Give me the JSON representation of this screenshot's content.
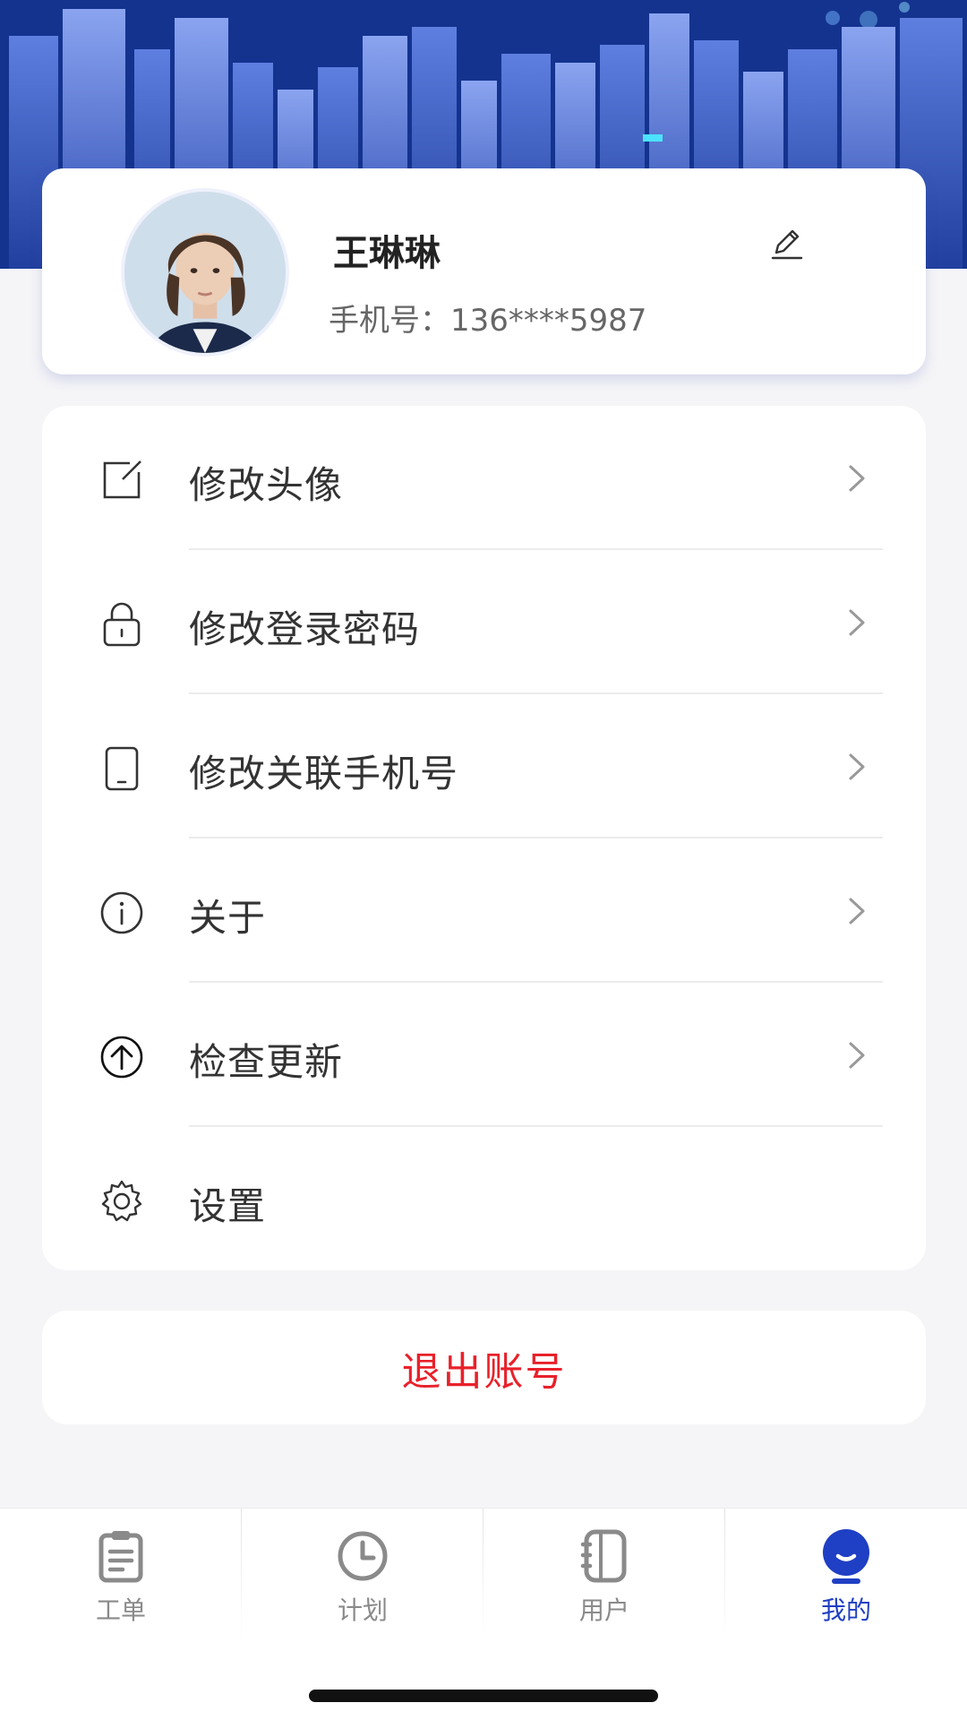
{
  "profile": {
    "name": "王琳琳",
    "phone": "手机号：136****5987"
  },
  "menu": {
    "items": [
      {
        "label": "修改头像",
        "icon": "edit-square-icon"
      },
      {
        "label": "修改登录密码",
        "icon": "lock-icon"
      },
      {
        "label": "修改关联手机号",
        "icon": "phone-icon"
      },
      {
        "label": "关于",
        "icon": "info-icon"
      },
      {
        "label": "检查更新",
        "icon": "upload-arrow-icon"
      },
      {
        "label": "设置",
        "icon": "gear-icon"
      }
    ]
  },
  "logout": {
    "label": "退出账号",
    "color": "#e8212a"
  },
  "tabbar": {
    "items": [
      {
        "label": "工单",
        "icon": "clipboard-icon",
        "active": false
      },
      {
        "label": "计划",
        "icon": "clock-icon",
        "active": false
      },
      {
        "label": "用户",
        "icon": "contacts-icon",
        "active": false
      },
      {
        "label": "我的",
        "icon": "smile-icon",
        "active": true
      }
    ],
    "active_color": "#1f3fc4",
    "inactive_color": "#8a8a8a"
  }
}
